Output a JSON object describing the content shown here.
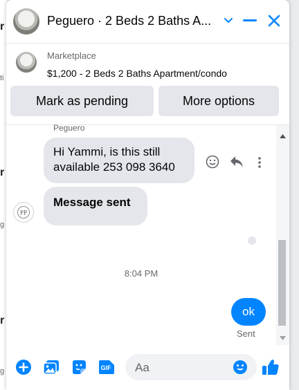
{
  "background": {
    "letters": [
      "r",
      "r",
      "r"
    ],
    "fragments": [
      "ti",
      "g",
      "g"
    ]
  },
  "chat": {
    "header": {
      "title": "Peguero · 2 Beds 2 Baths A...",
      "accent_color": "#0084ff"
    },
    "listing": {
      "source": "Marketplace",
      "title": "$1,200 - 2 Beds 2 Baths Apartment/condo",
      "mark_pending_label": "Mark as pending",
      "more_options_label": "More options"
    },
    "messages": {
      "sender_name": "Peguero",
      "incoming": [
        {
          "text": "Hi Yammi, is this still available 253 098 3640"
        },
        {
          "text": "Message sent"
        }
      ],
      "avatar_initials": "PP",
      "timestamp": "8:04 PM",
      "outgoing": {
        "text": "ok",
        "status": "Sent"
      }
    },
    "composer": {
      "placeholder": "Aa",
      "gif_label": "GIF"
    }
  }
}
